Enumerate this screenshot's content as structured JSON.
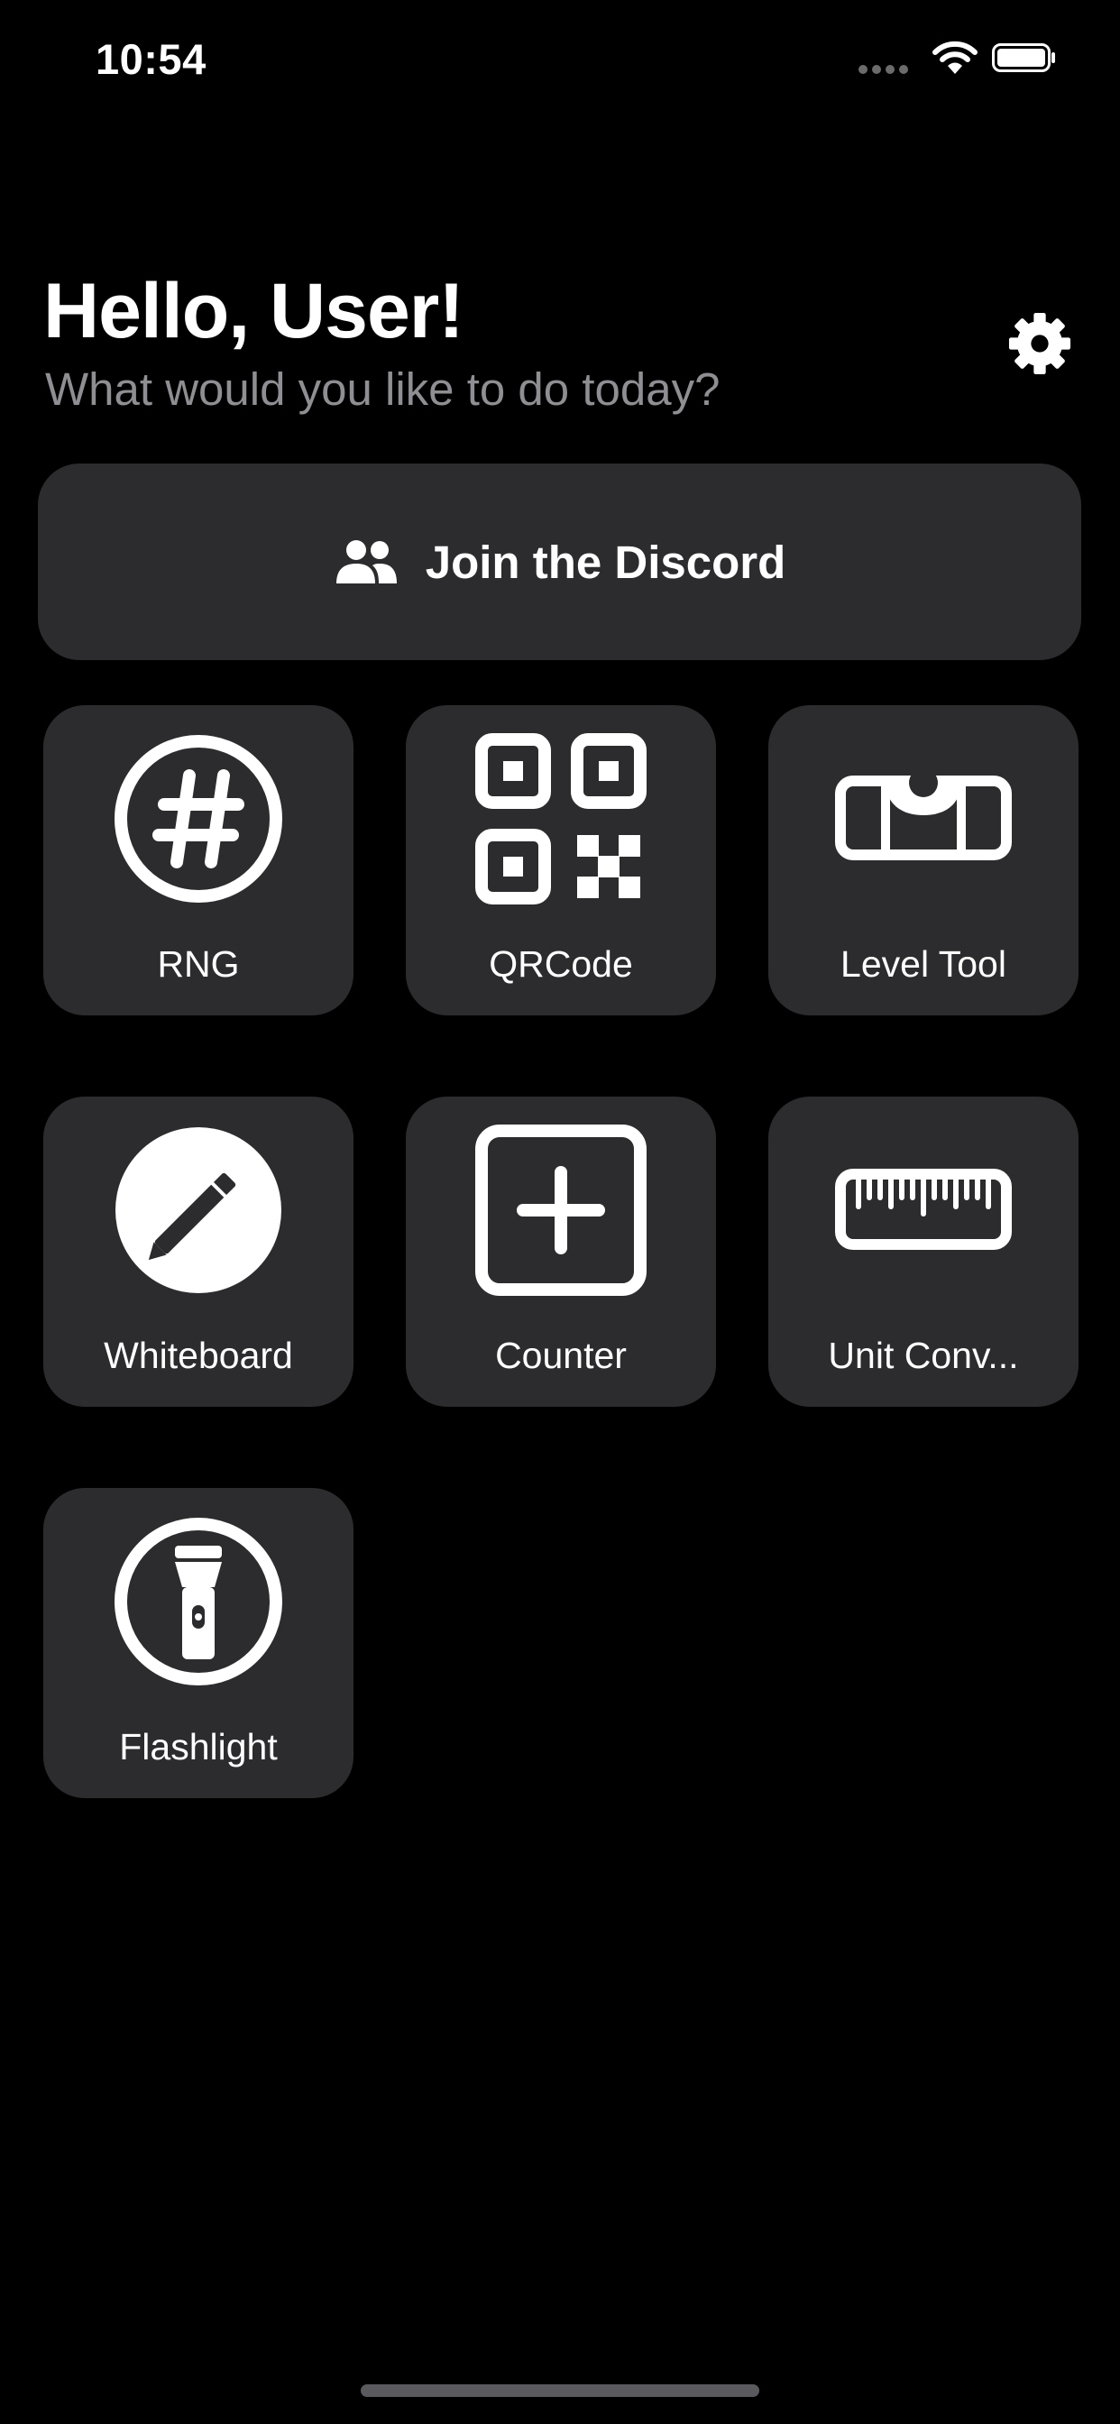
{
  "status_bar": {
    "time": "10:54"
  },
  "header": {
    "greeting": "Hello, User!",
    "subtitle": "What would you like to do today?",
    "settings_icon": "gear-icon"
  },
  "discord_button": {
    "label": "Join the Discord",
    "icon": "people-icon"
  },
  "tiles": [
    {
      "label": "RNG",
      "icon": "number-circle-icon"
    },
    {
      "label": "QRCode",
      "icon": "qrcode-icon"
    },
    {
      "label": "Level Tool",
      "icon": "level-icon"
    },
    {
      "label": "Whiteboard",
      "icon": "pencil-circle-icon"
    },
    {
      "label": "Counter",
      "icon": "plus-square-icon"
    },
    {
      "label": "Unit Conv...",
      "icon": "ruler-icon"
    },
    {
      "label": "Flashlight",
      "icon": "flashlight-icon"
    }
  ],
  "colors": {
    "background": "#000000",
    "card": "#2c2c2e",
    "text": "#ffffff",
    "secondary_text": "#8e8e93"
  }
}
